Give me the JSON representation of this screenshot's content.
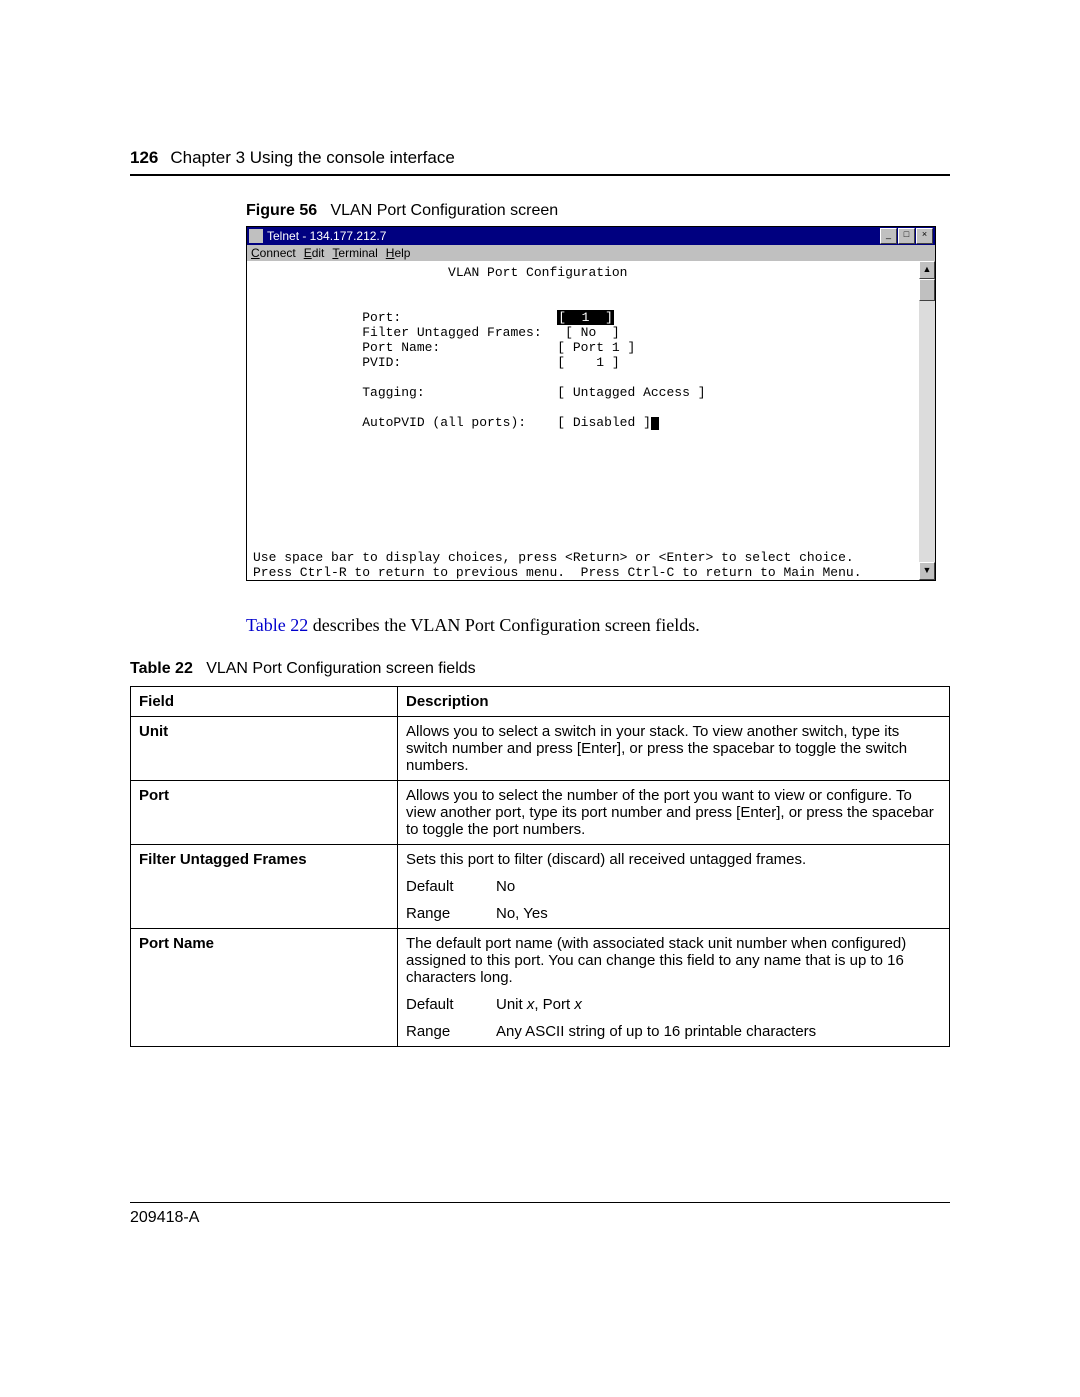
{
  "header": {
    "page_number": "126",
    "chapter": "Chapter 3  Using the console interface"
  },
  "figure": {
    "label": "Figure 56",
    "title": "VLAN Port Configuration screen"
  },
  "telnet": {
    "title": "Telnet - 134.177.212.7",
    "menu": {
      "connect": "Connect",
      "edit": "Edit",
      "terminal": "Terminal",
      "help": "Help"
    },
    "btn_min": "_",
    "btn_max": "□",
    "btn_close": "×",
    "sb_up": "▲",
    "sb_down": "▼",
    "screen_title": "VLAN Port Configuration",
    "rows": {
      "port_label": "Port:",
      "port_value": "1",
      "filter_label": "Filter Untagged Frames:",
      "filter_value": "[ No  ]",
      "name_label": "Port Name:",
      "name_value": "[ Port 1 ]",
      "pvid_label": "PVID:",
      "pvid_value": "[    1 ]",
      "tagging_label": "Tagging:",
      "tagging_value": "[ Untagged Access ]",
      "autopvid_label": "AutoPVID (all ports):",
      "autopvid_value": "[ Disabled ]"
    },
    "help1": "Use space bar to display choices, press <Return> or <Enter> to select choice.",
    "help2": "Press Ctrl-R to return to previous menu.  Press Ctrl-C to return to Main Menu."
  },
  "body_para": {
    "link_text": "Table 22",
    "rest": " describes the VLAN Port Configuration screen fields."
  },
  "table_caption": {
    "label": "Table 22",
    "title": "VLAN Port Configuration screen fields"
  },
  "table": {
    "h_field": "Field",
    "h_desc": "Description",
    "rows": {
      "unit": {
        "field": "Unit",
        "desc": "Allows you to select a switch in your stack. To view another switch, type its switch number and press [Enter], or press the spacebar to toggle the switch numbers."
      },
      "port": {
        "field": "Port",
        "desc": "Allows you to select the number of the port you want to view or configure. To view another port, type its port number and press [Enter], or press the spacebar to toggle the port numbers."
      },
      "filter": {
        "field": "Filter Untagged Frames",
        "desc": "Sets this port to filter (discard) all received untagged frames.",
        "default_k": "Default",
        "default_v": "No",
        "range_k": "Range",
        "range_v": "No, Yes"
      },
      "name": {
        "field": "Port Name",
        "desc": "The default port name (with associated stack unit number when configured) assigned to this port. You can change this field to any name that is up to 16 characters long.",
        "default_k": "Default",
        "default_pre": "Unit ",
        "default_x1": "x",
        "default_mid": ", Port ",
        "default_x2": "x",
        "range_k": "Range",
        "range_v": "Any ASCII string of up to 16 printable characters"
      }
    }
  },
  "footer": {
    "doc_id": "209418-A"
  }
}
